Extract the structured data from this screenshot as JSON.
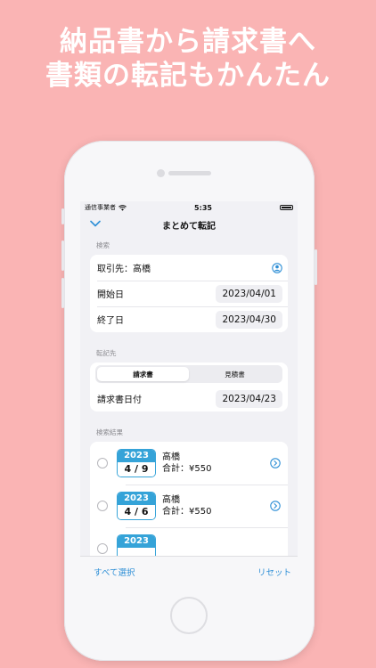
{
  "headline": {
    "line1": "納品書から請求書へ",
    "line2": "書類の転記もかんたん"
  },
  "status_bar": {
    "carrier": "通信事業者",
    "time": "5:35"
  },
  "nav": {
    "title": "まとめて転記",
    "back_icon": "chevron-down-icon"
  },
  "search": {
    "section_label": "検索",
    "client_label": "取引先：高橋",
    "start_label": "開始日",
    "start_date": "2023/04/01",
    "end_label": "終了日",
    "end_date": "2023/04/30"
  },
  "destination": {
    "section_label": "転記先",
    "segments": [
      "請求書",
      "見積書"
    ],
    "selected_segment": "請求書",
    "date_label": "請求書日付",
    "date_value": "2023/04/23"
  },
  "results": {
    "section_label": "検索結果",
    "items": [
      {
        "year": "2023",
        "day": "4 / 9",
        "name": "高橋",
        "total": "合計：¥550"
      },
      {
        "year": "2023",
        "day": "4 / 6",
        "name": "高橋",
        "total": "合計：¥550"
      },
      {
        "year": "2023",
        "day": "",
        "name": "",
        "total": ""
      }
    ]
  },
  "toolbar": {
    "select_all": "すべて選択",
    "reset": "リセット"
  },
  "colors": {
    "background": "#fab4b4",
    "accent": "#35a3d8",
    "link": "#2e8fd6"
  }
}
